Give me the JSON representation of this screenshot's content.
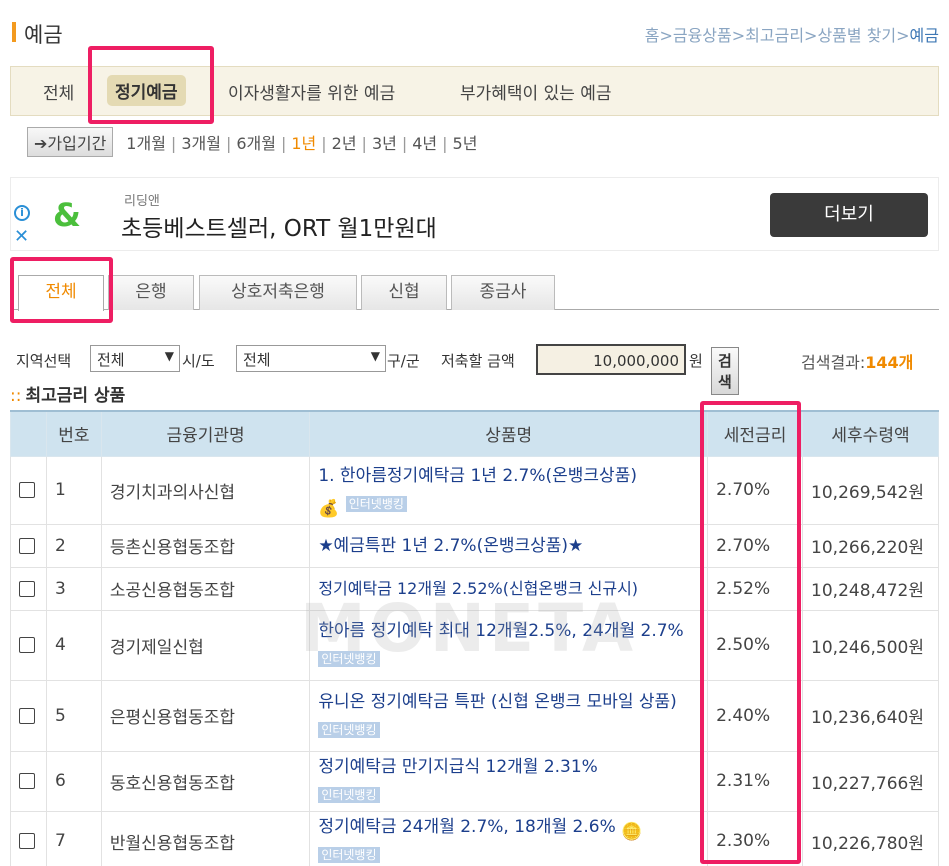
{
  "header": {
    "title": "예금",
    "breadcrumb": [
      "홈",
      "금융상품",
      "최고금리",
      "상품별 찾기",
      "예금"
    ],
    "breadcrumb_sep": ">"
  },
  "categories": [
    {
      "label": "전체"
    },
    {
      "label": "정기예금",
      "selected": true
    },
    {
      "label": "이자생활자를 위한 예금"
    },
    {
      "label": "부가혜택이 있는 예금"
    }
  ],
  "period": {
    "label": "➔가입기간",
    "options": [
      "1개월",
      "3개월",
      "6개월",
      "1년",
      "2년",
      "3년",
      "4년",
      "5년"
    ],
    "selected": "1년"
  },
  "ad": {
    "brand": "리딩앤",
    "headline": "초등베스트셀러, ORT 월1만원대",
    "button": "더보기",
    "logo": "&"
  },
  "inst_tabs": [
    {
      "label": "전체",
      "selected": true
    },
    {
      "label": "은행"
    },
    {
      "label": "상호저축은행"
    },
    {
      "label": "신협"
    },
    {
      "label": "종금사"
    }
  ],
  "filter": {
    "region_label": "지역선택",
    "region_value": "전체",
    "city_label": "시/도",
    "district_value": "전체",
    "district_label": "구/군",
    "amount_label": "저축할 금액",
    "amount_value": "10,000,000",
    "amount_unit": "원",
    "search_button": "검색",
    "result_label": "검색결과:",
    "result_count": "144개"
  },
  "section_title": "최고금리 상품",
  "table": {
    "headers": [
      "번호",
      "금융기관명",
      "상품명",
      "세전금리",
      "세후수령액"
    ],
    "online_badge": "인터넷뱅킹",
    "rows": [
      {
        "no": "1",
        "inst": "경기치과의사신협",
        "product": "1. 한아름정기예탁금 1년 2.7%(온뱅크상품)",
        "rate": "2.70%",
        "after": "10,269,542원"
      },
      {
        "no": "2",
        "inst": "등촌신용협동조합",
        "product": "★예금특판 1년 2.7%(온뱅크상품)★",
        "rate": "2.70%",
        "after": "10,266,220원"
      },
      {
        "no": "3",
        "inst": "소공신용협동조합",
        "product": "정기예탁금 12개월 2.52%(신협온뱅크 신규시)",
        "rate": "2.52%",
        "after": "10,248,472원"
      },
      {
        "no": "4",
        "inst": "경기제일신협",
        "product": "한아름 정기예탁 최대 12개월2.5%, 24개월 2.7%",
        "rate": "2.50%",
        "after": "10,246,500원"
      },
      {
        "no": "5",
        "inst": "은평신용협동조합",
        "product": "유니온 정기예탁금 특판 (신협 온뱅크 모바일 상품)",
        "rate": "2.40%",
        "after": "10,236,640원"
      },
      {
        "no": "6",
        "inst": "동호신용협동조합",
        "product": "정기예탁금 만기지급식 12개월 2.31%",
        "rate": "2.31%",
        "after": "10,227,766원"
      },
      {
        "no": "7",
        "inst": "반월신용협동조합",
        "product": "정기예탁금 24개월 2.7%, 18개월 2.6%",
        "rate": "2.30%",
        "after": "10,226,780원"
      }
    ]
  },
  "watermark": "MONETA",
  "colors": {
    "accent": "#f08a00",
    "highlight": "#ee1e63",
    "table_header": "#cfe3ef",
    "link": "#1c3f8c"
  }
}
